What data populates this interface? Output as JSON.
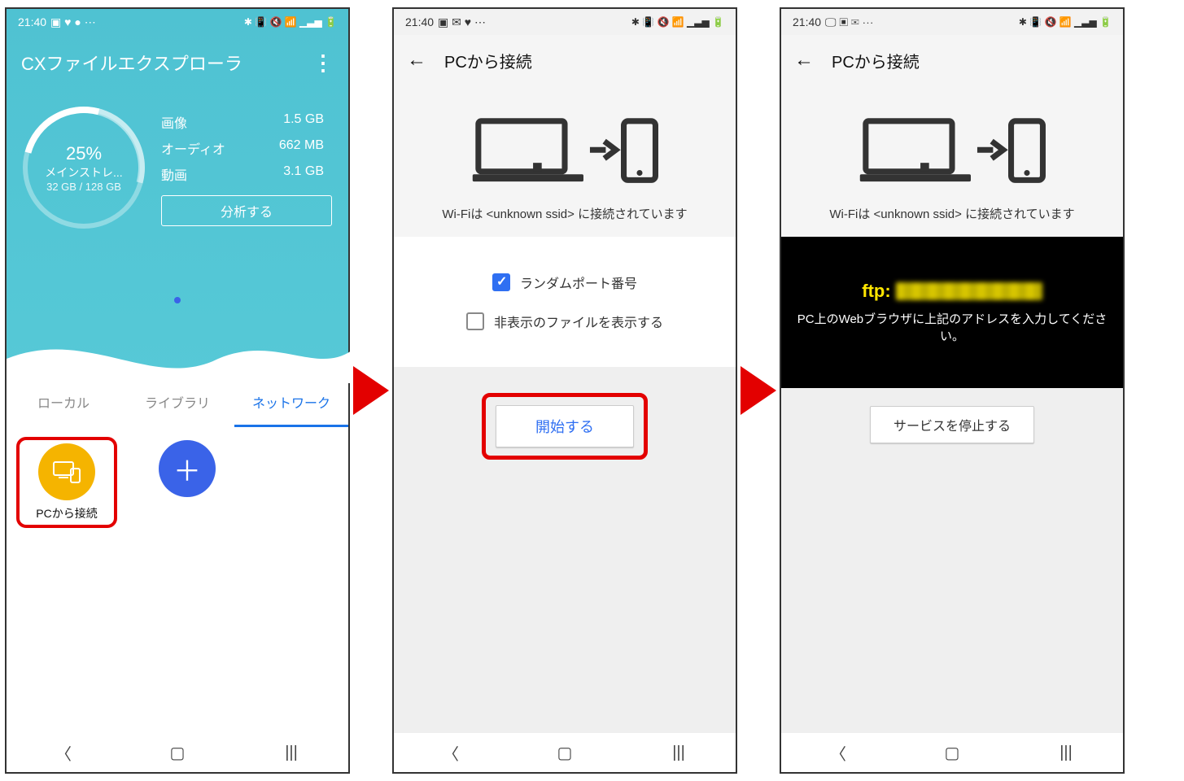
{
  "status": {
    "time": "21:40",
    "icons_right": "✱ 📳 🔇 📶 ▁▃▅ 🔋"
  },
  "screen1": {
    "title": "CXファイルエクスプローラ",
    "gauge": {
      "percent": "25%",
      "line1": "メインストレ...",
      "line2": "32 GB / 128 GB"
    },
    "stats": [
      {
        "label": "画像",
        "value": "1.5 GB"
      },
      {
        "label": "オーディオ",
        "value": "662 MB"
      },
      {
        "label": "動画",
        "value": "3.1 GB"
      }
    ],
    "analyze": "分析する",
    "tabs": [
      "ローカル",
      "ライブラリ",
      "ネットワーク"
    ],
    "pc_connect": "PCから接続"
  },
  "screen2": {
    "title": "PCから接続",
    "wifi_line": "Wi-Fiは <unknown ssid> に接続されています",
    "opt1": "ランダムポート番号",
    "opt2": "非表示のファイルを表示する",
    "start": "開始する"
  },
  "screen3": {
    "title": "PCから接続",
    "wifi_line": "Wi-Fiは <unknown ssid> に接続されています",
    "ftp_prefix": "ftp:",
    "ftp_sub": "PC上のWebブラウザに上記のアドレスを入力してください。",
    "stop": "サービスを停止する"
  }
}
